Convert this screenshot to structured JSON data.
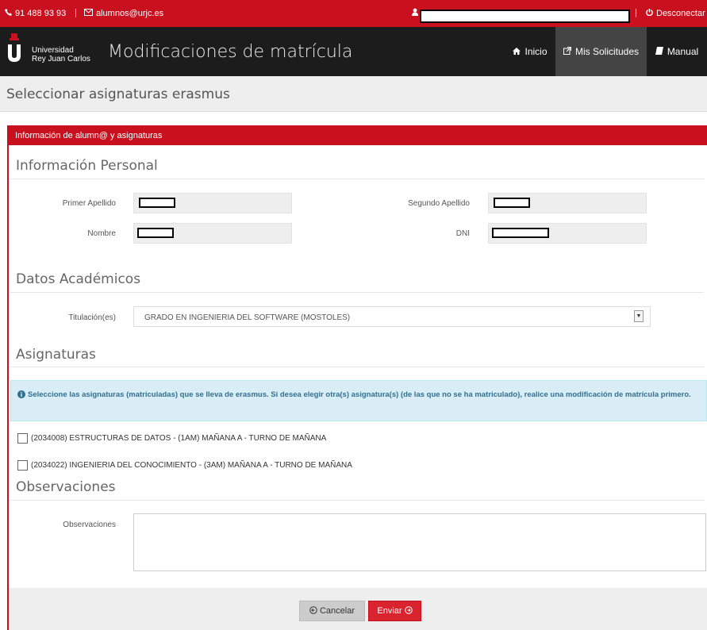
{
  "topbar": {
    "phone": "91 488 93 93",
    "email": "alumnos@urjc.es",
    "logout": "Desconectar"
  },
  "nav": {
    "university_line1": "Universidad",
    "university_line2": "Rey Juan Carlos",
    "app_title": "Modificaciones de matrícula",
    "items": [
      {
        "label": "Inicio",
        "icon": "home-icon"
      },
      {
        "label": "Mis Solicitudes",
        "icon": "external-icon"
      },
      {
        "label": "Manual",
        "icon": "book-icon"
      }
    ]
  },
  "page": {
    "heading": "Seleccionar asignaturas erasmus"
  },
  "panel": {
    "title": "Información de alumn@ y asignaturas"
  },
  "personal": {
    "heading": "Información Personal",
    "primer_apellido_label": "Primer Apellido",
    "segundo_apellido_label": "Segundo Apellido",
    "nombre_label": "Nombre",
    "dni_label": "DNI"
  },
  "academic": {
    "heading": "Datos Académicos",
    "titulacion_label": "Titulación(es)",
    "titulacion_value": "GRADO EN INGENIERIA DEL SOFTWARE (MOSTOLES)"
  },
  "subjects": {
    "heading": "Asignaturas",
    "info": "Seleccione las asignaturas (matriculadas) que se lleva de erasmus. Si desea elegir otra(s) asignatura(s) (de las que no se ha matriculado), realice una modificación de matrícula primero.",
    "items": [
      "(2034008) ESTRUCTURAS DE DATOS - (1AM) MAÑANA A - TURNO DE MAÑANA",
      "(2034022) INGENIERIA DEL CONOCIMIENTO - (3AM) MAÑANA A - TURNO DE MAÑANA"
    ]
  },
  "observations": {
    "heading": "Observaciones",
    "label": "Observaciones"
  },
  "actions": {
    "cancel": "Cancelar",
    "send": "Enviar"
  },
  "colors": {
    "brand_red": "#c8101e",
    "nav_dark": "#1c1c1c",
    "info_bg": "#d9edf7"
  }
}
